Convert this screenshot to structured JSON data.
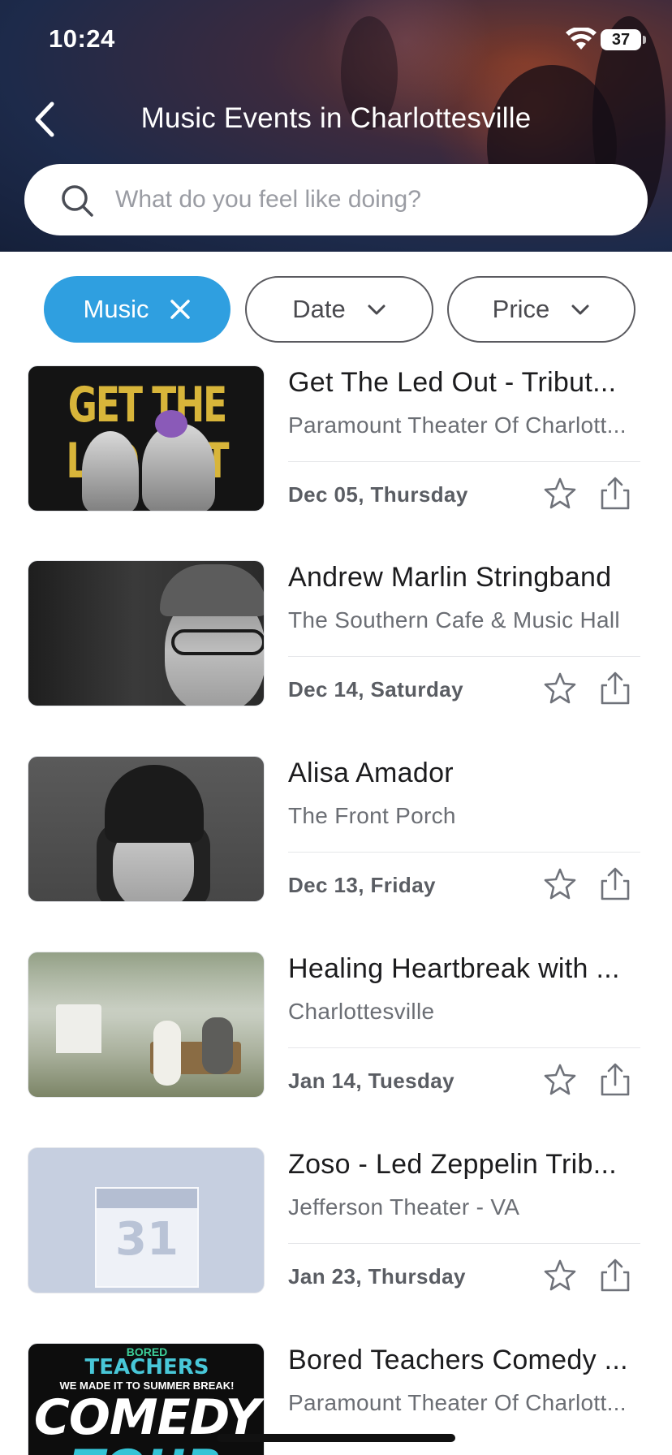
{
  "status_bar": {
    "time": "10:24",
    "battery": "37"
  },
  "header": {
    "title": "Music Events in Charlottesville",
    "search_placeholder": "What do you feel like doing?"
  },
  "filters": {
    "active": {
      "label": "Music"
    },
    "date": {
      "label": "Date"
    },
    "price": {
      "label": "Price"
    }
  },
  "events": [
    {
      "title": "Get The Led Out - Tribut...",
      "venue": "Paramount Theater Of Charlott...",
      "date": "Dec 05, Thursday",
      "thumb_text": "GET THE LED OUT"
    },
    {
      "title": "Andrew Marlin Stringband",
      "venue": "The Southern Cafe & Music Hall",
      "date": "Dec 14, Saturday"
    },
    {
      "title": "Alisa Amador",
      "venue": "The Front Porch",
      "date": "Dec 13, Friday"
    },
    {
      "title": "Healing Heartbreak with ...",
      "venue": "Charlottesville",
      "date": "Jan 14, Tuesday"
    },
    {
      "title": "Zoso - Led Zeppelin Trib...",
      "venue": "Jefferson Theater - VA",
      "date": "Jan 23, Thursday",
      "thumb_text": "31"
    },
    {
      "title": "Bored Teachers Comedy ...",
      "venue": "Paramount Theater Of Charlott...",
      "date": "",
      "thumb_lines": [
        "BORED",
        "TEACHERS",
        "WE MADE IT TO SUMMER BREAK!",
        "COMEDY",
        "TOUR"
      ]
    }
  ],
  "colors": {
    "accent": "#2f9fe0",
    "header_dark": "#1d2a4a"
  }
}
